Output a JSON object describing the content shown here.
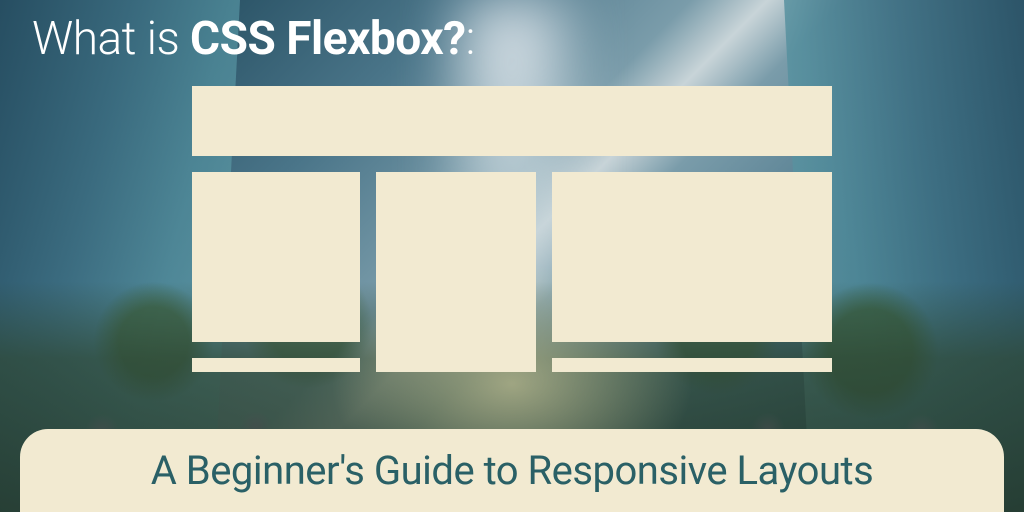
{
  "title": {
    "prefix": "What is ",
    "bold": "CSS Flexbox?",
    "suffix": ":"
  },
  "subtitle": "A Beginner's Guide to Responsive Layouts",
  "colors": {
    "cream": "#f2ead1",
    "teal": "#2a6066"
  }
}
